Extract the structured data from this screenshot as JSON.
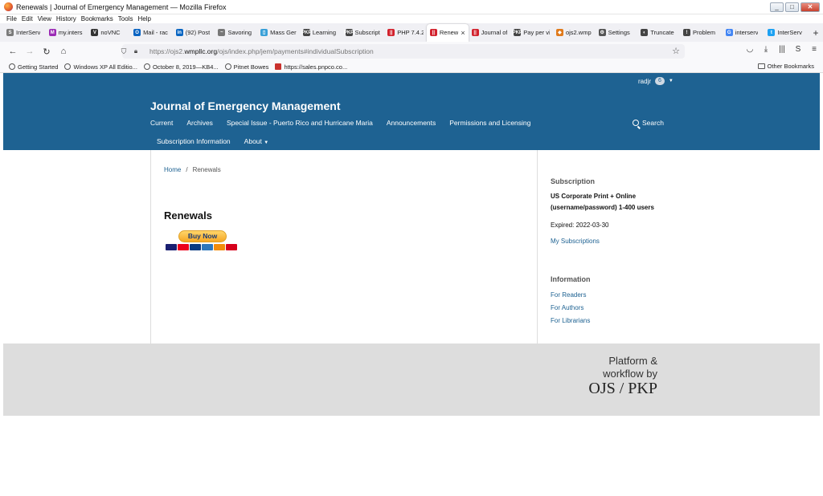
{
  "window": {
    "title": "Renewals | Journal of Emergency Management — Mozilla Firefox",
    "min": "_",
    "max": "□",
    "close": "✕"
  },
  "menu": [
    "File",
    "Edit",
    "View",
    "History",
    "Bookmarks",
    "Tools",
    "Help"
  ],
  "tabs": [
    {
      "label": "InterServ",
      "icon_color": "#7a7a7a",
      "icon": "S"
    },
    {
      "label": "my.inters",
      "icon_color": "#9b2bb5",
      "icon": "M"
    },
    {
      "label": "noVNC",
      "icon_color": "#333333",
      "icon": "V"
    },
    {
      "label": "Mail - rac",
      "icon_color": "#0a64c2",
      "icon": "O"
    },
    {
      "label": "(92) Post",
      "icon_color": "#0a66c2",
      "icon": "in"
    },
    {
      "label": "Savoring",
      "icon_color": "#777777",
      "icon": "~"
    },
    {
      "label": "Mass Ger",
      "icon_color": "#3aa0d8",
      "icon": "▯"
    },
    {
      "label": "Learning",
      "icon_color": "#444444",
      "icon": "PKP"
    },
    {
      "label": "Subscript",
      "icon_color": "#444444",
      "icon": "PKP"
    },
    {
      "label": "PHP 7.4.2",
      "icon_color": "#d2222d",
      "icon": "||"
    },
    {
      "label": "Renewals",
      "icon_color": "#d2222d",
      "icon": "||",
      "active": true
    },
    {
      "label": "Journal of",
      "icon_color": "#d2222d",
      "icon": "||"
    },
    {
      "label": "Pay per vi",
      "icon_color": "#444444",
      "icon": "PKP"
    },
    {
      "label": "ojs2.wmp",
      "icon_color": "#e07a1b",
      "icon": "◆"
    },
    {
      "label": "Settings",
      "icon_color": "#555555",
      "icon": "⚙"
    },
    {
      "label": "Truncate",
      "icon_color": "#444444",
      "icon": "◐"
    },
    {
      "label": "Problem",
      "icon_color": "#444444",
      "icon": "!"
    },
    {
      "label": "interserv",
      "icon_color": "#4285f4",
      "icon": "G"
    },
    {
      "label": "InterServ",
      "icon_color": "#1da1f2",
      "icon": "t"
    }
  ],
  "nav": {
    "url_prefix": "https://ojs2.",
    "url_domain": "wmpllc.org",
    "url_path": "/ojs/index.php/jem/payments#individualSubscription"
  },
  "bookmarks": [
    {
      "label": "Getting Started"
    },
    {
      "label": "Windows XP All Editio..."
    },
    {
      "label": "October 8, 2019—KB4..."
    },
    {
      "label": "Pitnet Bowes"
    },
    {
      "label": "https://sales.pnpco.co..."
    }
  ],
  "other_bookmarks": "Other Bookmarks",
  "site": {
    "user": "radjr",
    "notifications": "6",
    "journal_title": "Journal of Emergency Management",
    "nav_primary": [
      "Current",
      "Archives",
      "Special Issue - Puerto Rico and Hurricane Maria",
      "Announcements",
      "Permissions and Licensing"
    ],
    "nav_secondary": [
      "Subscription Information",
      "About"
    ],
    "search": "Search",
    "breadcrumb_home": "Home",
    "breadcrumb_sep": "/",
    "breadcrumb_current": "Renewals",
    "heading": "Renewals",
    "buy_now": "Buy Now",
    "card_colors": [
      "#1a1f71",
      "#eb001b",
      "#0a3a82",
      "#2e77bb",
      "#f28c0a",
      "#d6001c"
    ]
  },
  "sidebar": {
    "subscription_title": "Subscription",
    "subscription_line1": "US Corporate Print + Online",
    "subscription_line2": "(username/password) 1-400 users",
    "expired": "Expired: 2022-03-30",
    "my_subscriptions": "My Subscriptions",
    "information_title": "Information",
    "for_readers": "For Readers",
    "for_authors": "For Authors",
    "for_librarians": "For Librarians"
  },
  "footer": {
    "line1": "Platform &",
    "line2": "workflow by",
    "line3": "OJS / PKP"
  },
  "colors": {
    "header": "#1e6292",
    "link": "#1e6292",
    "footer": "#dddddd"
  }
}
